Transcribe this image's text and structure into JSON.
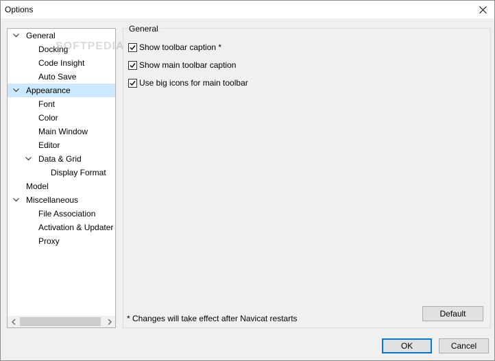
{
  "window": {
    "title": "Options"
  },
  "tree": {
    "items": [
      {
        "label": "General",
        "expanded": true,
        "level": 0
      },
      {
        "label": "Docking",
        "level": 1
      },
      {
        "label": "Code Insight",
        "level": 1
      },
      {
        "label": "Auto Save",
        "level": 1
      },
      {
        "label": "Appearance",
        "expanded": true,
        "level": 0,
        "selected": true
      },
      {
        "label": "Font",
        "level": 1
      },
      {
        "label": "Color",
        "level": 1
      },
      {
        "label": "Main Window",
        "level": 1
      },
      {
        "label": "Editor",
        "level": 1
      },
      {
        "label": "Data & Grid",
        "expanded": true,
        "level": 1
      },
      {
        "label": "Display Format",
        "level": 2
      },
      {
        "label": "Model",
        "level": 0
      },
      {
        "label": "Miscellaneous",
        "expanded": true,
        "level": 0
      },
      {
        "label": "File Association",
        "level": 1
      },
      {
        "label": "Activation & Updater",
        "level": 1
      },
      {
        "label": "Proxy",
        "level": 1
      }
    ]
  },
  "general_group": {
    "title": "General",
    "options": [
      {
        "label": "Show toolbar caption *",
        "checked": true
      },
      {
        "label": "Show main toolbar caption",
        "checked": true
      },
      {
        "label": "Use big icons for main toolbar",
        "checked": true
      }
    ],
    "note": "* Changes will take effect after Navicat restarts",
    "default_label": "Default"
  },
  "footer": {
    "ok_label": "OK",
    "cancel_label": "Cancel"
  },
  "watermark": "SOFTPEDIA",
  "colors": {
    "selection": "#cce8ff",
    "accent": "#0078d7"
  }
}
